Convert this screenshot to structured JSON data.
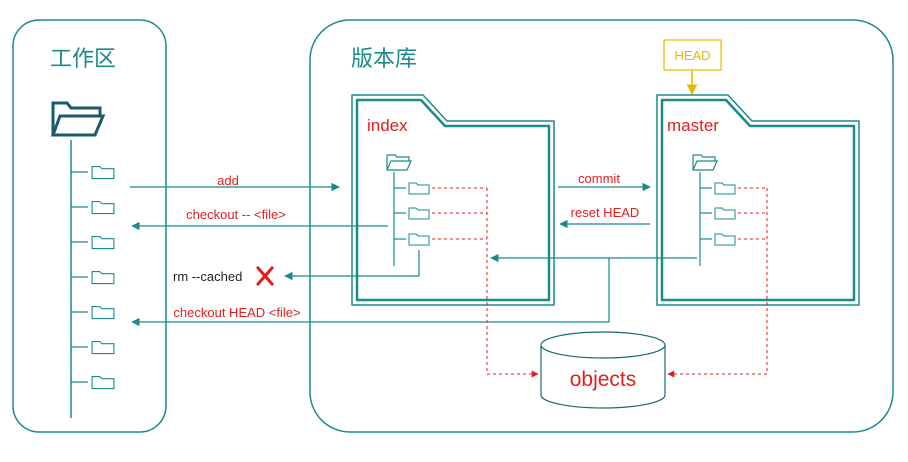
{
  "workspace": {
    "title": "工作区"
  },
  "repository": {
    "title": "版本库"
  },
  "index": {
    "label": "index"
  },
  "master": {
    "label": "master"
  },
  "head": {
    "label": "HEAD"
  },
  "objects": {
    "label": "objects"
  },
  "arrows": {
    "add": "add",
    "checkout_file": "checkout -- <file>",
    "rm_cached": "rm --cached",
    "checkout_head_file": "checkout HEAD <file>",
    "commit": "commit",
    "reset_head": "reset HEAD"
  },
  "colors": {
    "teal": "#1a8a8a",
    "red": "#e02020",
    "head_border": "#e5b800"
  },
  "icons": [
    "folder-open-icon",
    "folder-icon",
    "cross-icon",
    "cylinder-icon"
  ]
}
